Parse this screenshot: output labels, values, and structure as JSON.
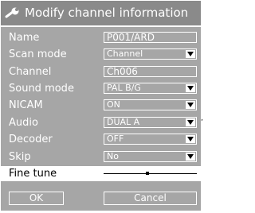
{
  "dialog": {
    "title": "Modify channel information",
    "icon": "wrench-icon"
  },
  "fields": {
    "name": {
      "label": "Name",
      "value": "P001/ARD"
    },
    "scan_mode": {
      "label": "Scan mode",
      "value": "Channel"
    },
    "channel": {
      "label": "Channel",
      "value": "Ch006"
    },
    "sound_mode": {
      "label": "Sound mode",
      "value": "PAL B/G"
    },
    "nicam": {
      "label": "NICAM",
      "value": "ON"
    },
    "audio": {
      "label": "Audio",
      "value": "DUAL A"
    },
    "decoder": {
      "label": "Decoder",
      "value": "OFF"
    },
    "skip": {
      "label": "Skip",
      "value": "No"
    },
    "fine_tune": {
      "label": "Fine tune",
      "level_fraction": 0.47
    }
  },
  "buttons": {
    "ok": "OK",
    "cancel": "Cancel"
  },
  "colors": {
    "panel": "#a6a6a6",
    "titlebar": "#8a8a8a",
    "text": "#ffffff",
    "selected_row": "#ffffff"
  }
}
